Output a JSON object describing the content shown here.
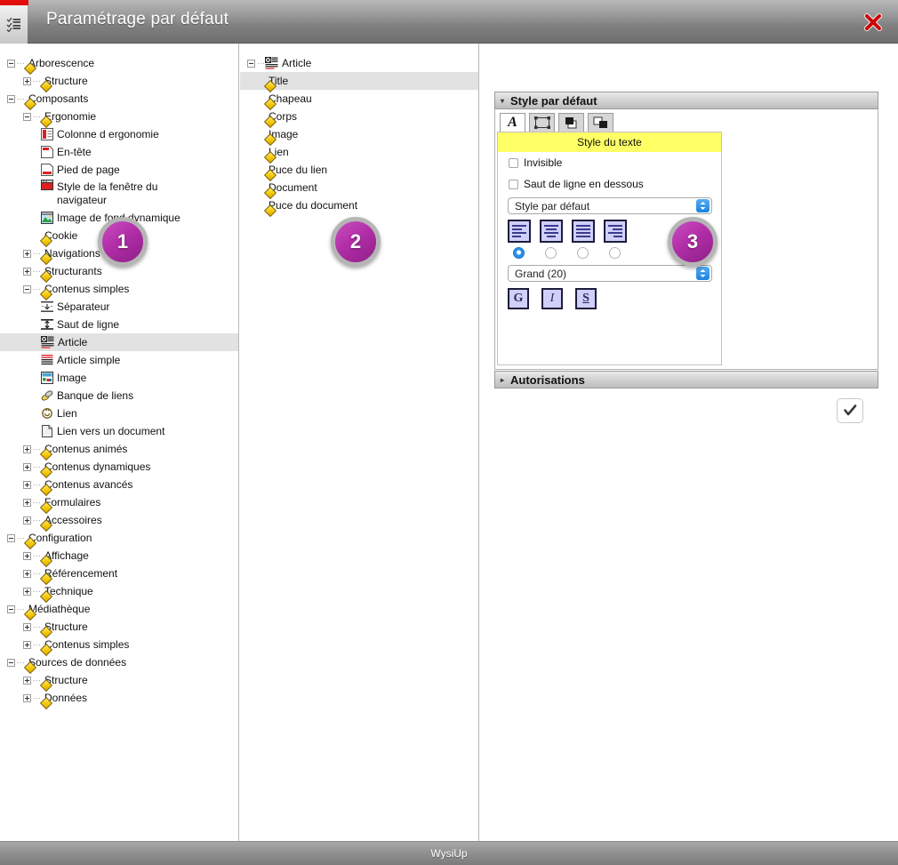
{
  "window": {
    "title": "Paramétrage par défaut",
    "menu_icon": "list-menu-icon",
    "close_icon": "close-icon",
    "accent_red": "#e20d0d",
    "badge_color": "#b22ea8"
  },
  "footer": {
    "label": "WysiUp"
  },
  "badges": [
    {
      "number": "1"
    },
    {
      "number": "2"
    },
    {
      "number": "3"
    }
  ],
  "left_tree": [
    {
      "label": "Arborescence",
      "depth": 0,
      "toggle": "minus",
      "icon": "diamond"
    },
    {
      "label": "Structure",
      "depth": 1,
      "toggle": "plus",
      "icon": "diamond"
    },
    {
      "label": "Composants",
      "depth": 0,
      "toggle": "minus",
      "icon": "diamond"
    },
    {
      "label": "Ergonomie",
      "depth": 1,
      "toggle": "minus",
      "icon": "diamond"
    },
    {
      "label": "Colonne d ergonomie",
      "depth": 2,
      "toggle": "none",
      "icon": "column-icon"
    },
    {
      "label": "En-tête",
      "depth": 2,
      "toggle": "none",
      "icon": "header-icon"
    },
    {
      "label": "Pied de page",
      "depth": 2,
      "toggle": "none",
      "icon": "footer-icon"
    },
    {
      "label": "Style de la fenêtre du navigateur",
      "depth": 2,
      "toggle": "none",
      "icon": "window-style-icon",
      "wrap": true
    },
    {
      "label": "Image de fond dynamique",
      "depth": 2,
      "toggle": "none",
      "icon": "background-image-icon"
    },
    {
      "label": "Cookie",
      "depth": 2,
      "toggle": "none",
      "icon": "diamond"
    },
    {
      "label": "Navigations",
      "depth": 1,
      "toggle": "plus",
      "icon": "diamond"
    },
    {
      "label": "Structurants",
      "depth": 1,
      "toggle": "plus",
      "icon": "diamond"
    },
    {
      "label": "Contenus simples",
      "depth": 1,
      "toggle": "minus",
      "icon": "diamond"
    },
    {
      "label": "Séparateur",
      "depth": 2,
      "toggle": "none",
      "icon": "separator-icon"
    },
    {
      "label": "Saut de ligne",
      "depth": 2,
      "toggle": "none",
      "icon": "line-break-icon"
    },
    {
      "label": "Article",
      "depth": 2,
      "toggle": "none",
      "icon": "article-icon",
      "selected": true
    },
    {
      "label": "Article simple",
      "depth": 2,
      "toggle": "none",
      "icon": "simple-article-icon"
    },
    {
      "label": "Image",
      "depth": 2,
      "toggle": "none",
      "icon": "image-icon"
    },
    {
      "label": "Banque de liens",
      "depth": 2,
      "toggle": "none",
      "icon": "link-bank-icon"
    },
    {
      "label": "Lien",
      "depth": 2,
      "toggle": "none",
      "icon": "link-icon"
    },
    {
      "label": "Lien vers un document",
      "depth": 2,
      "toggle": "none",
      "icon": "document-link-icon"
    },
    {
      "label": "Contenus animés",
      "depth": 1,
      "toggle": "plus",
      "icon": "diamond"
    },
    {
      "label": "Contenus dynamiques",
      "depth": 1,
      "toggle": "plus",
      "icon": "diamond"
    },
    {
      "label": "Contenus avancés",
      "depth": 1,
      "toggle": "plus",
      "icon": "diamond"
    },
    {
      "label": "Formulaires",
      "depth": 1,
      "toggle": "plus",
      "icon": "diamond"
    },
    {
      "label": "Accessoires",
      "depth": 1,
      "toggle": "plus",
      "icon": "diamond"
    },
    {
      "label": "Configuration",
      "depth": 0,
      "toggle": "minus",
      "icon": "diamond"
    },
    {
      "label": "Affichage",
      "depth": 1,
      "toggle": "plus",
      "icon": "diamond"
    },
    {
      "label": "Référencement",
      "depth": 1,
      "toggle": "plus",
      "icon": "diamond"
    },
    {
      "label": "Technique",
      "depth": 1,
      "toggle": "plus",
      "icon": "diamond"
    },
    {
      "label": "Médiathèque",
      "depth": 0,
      "toggle": "minus",
      "icon": "diamond"
    },
    {
      "label": "Structure",
      "depth": 1,
      "toggle": "plus",
      "icon": "diamond"
    },
    {
      "label": "Contenus simples",
      "depth": 1,
      "toggle": "plus",
      "icon": "diamond"
    },
    {
      "label": "Sources de données",
      "depth": 0,
      "toggle": "minus",
      "icon": "diamond"
    },
    {
      "label": "Structure",
      "depth": 1,
      "toggle": "plus",
      "icon": "diamond"
    },
    {
      "label": "Données",
      "depth": 1,
      "toggle": "plus",
      "icon": "diamond"
    }
  ],
  "mid_tree": [
    {
      "label": "Article",
      "depth": 0,
      "toggle": "minus",
      "icon": "article-icon"
    },
    {
      "label": "Title",
      "depth": 1,
      "toggle": "none",
      "icon": "diamond",
      "selected": true
    },
    {
      "label": "Chapeau",
      "depth": 1,
      "toggle": "none",
      "icon": "diamond"
    },
    {
      "label": "Corps",
      "depth": 1,
      "toggle": "none",
      "icon": "diamond"
    },
    {
      "label": "Image",
      "depth": 1,
      "toggle": "none",
      "icon": "diamond"
    },
    {
      "label": "Lien",
      "depth": 1,
      "toggle": "none",
      "icon": "diamond"
    },
    {
      "label": "Puce du lien",
      "depth": 1,
      "toggle": "none",
      "icon": "diamond"
    },
    {
      "label": "Document",
      "depth": 1,
      "toggle": "none",
      "icon": "diamond"
    },
    {
      "label": "Puce du document",
      "depth": 1,
      "toggle": "none",
      "icon": "diamond"
    }
  ],
  "right_panel": {
    "style_section": {
      "title": "Style par défaut",
      "arrow": "▾"
    },
    "permissions_section": {
      "title": "Autorisations",
      "arrow": "▸"
    },
    "toolbar": [
      {
        "name": "text-style-tab",
        "glyph": "A",
        "active": true
      },
      {
        "name": "box-style-tab",
        "glyph": "",
        "active": false
      },
      {
        "name": "shadow-style-tab",
        "glyph": "",
        "active": false
      },
      {
        "name": "background-style-tab",
        "glyph": "",
        "active": false
      }
    ],
    "form": {
      "title": "Style du texte",
      "checkbox_invisible": {
        "label": "Invisible",
        "checked": false
      },
      "checkbox_linebreak": {
        "label": "Saut de ligne en dessous",
        "checked": false
      },
      "style_select": {
        "value": "Style par défaut"
      },
      "alignment": {
        "options": [
          "align-left",
          "align-center",
          "align-justify",
          "align-right"
        ],
        "selected_index": 0
      },
      "size_select": {
        "value": "Grand (20)"
      },
      "format_buttons": [
        {
          "label": "G",
          "name": "bold-button"
        },
        {
          "label": "I",
          "name": "italic-button"
        },
        {
          "label": "S",
          "name": "underline-button"
        }
      ]
    },
    "validate_icon": "check-icon"
  }
}
